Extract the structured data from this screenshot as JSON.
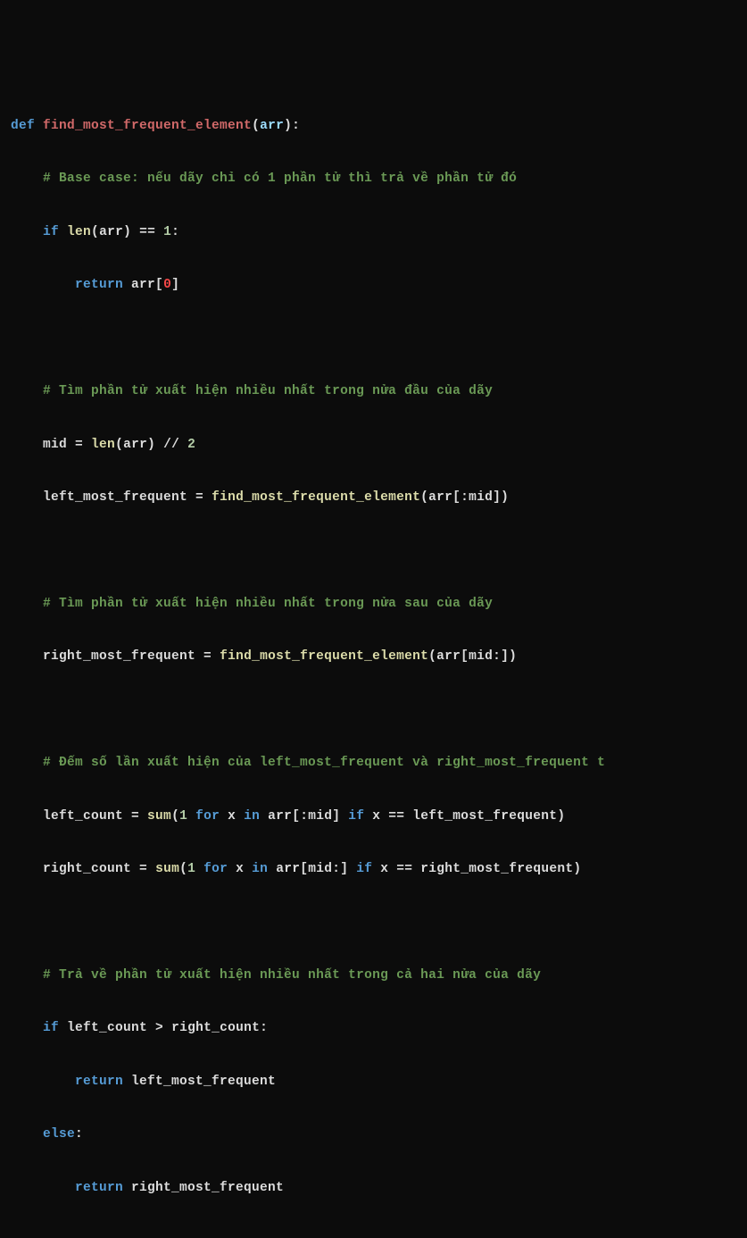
{
  "code": {
    "line1": {
      "def": "def ",
      "fname": "find_most_frequent_element",
      "paren_open": "(",
      "param": "arr",
      "paren_close_colon": "):"
    },
    "line2": {
      "indent": "    ",
      "comment": "# Base case: nếu dãy chỉ có 1 phần tử thì trả về phần tử đó"
    },
    "line3": {
      "indent": "    ",
      "if": "if ",
      "len": "len",
      "po": "(",
      "arr": "arr",
      "pc": ") ",
      "eq": "== ",
      "one": "1",
      "colon": ":"
    },
    "line4": {
      "indent": "        ",
      "return": "return ",
      "arr": "arr",
      "bo": "[",
      "zero": "0",
      "bc": "]"
    },
    "line5": {
      "blank": " "
    },
    "line6": {
      "indent": "    ",
      "comment": "# Tìm phần tử xuất hiện nhiều nhất trong nửa đầu của dãy"
    },
    "line7": {
      "indent": "    ",
      "mid": "mid ",
      "eq": "= ",
      "len": "len",
      "po": "(",
      "arr": "arr",
      "pc": ") ",
      "fd": "// ",
      "two": "2"
    },
    "line8": {
      "indent": "    ",
      "lmf": "left_most_frequent ",
      "eq": "= ",
      "fn": "find_most_frequent_element",
      "po": "(",
      "arr": "arr",
      "bo": "[:",
      "mid": "mid",
      "bc": "])"
    },
    "line9": {
      "blank": " "
    },
    "line10": {
      "indent": "    ",
      "comment": "# Tìm phần tử xuất hiện nhiều nhất trong nửa sau của dãy"
    },
    "line11": {
      "indent": "    ",
      "rmf": "right_most_frequent ",
      "eq": "= ",
      "fn": "find_most_frequent_element",
      "po": "(",
      "arr": "arr",
      "bo": "[",
      "mid": "mid",
      "bc": ":])"
    },
    "line12": {
      "blank": " "
    },
    "line13": {
      "indent": "    ",
      "comment": "# Đếm số lần xuất hiện của left_most_frequent và right_most_frequent t"
    },
    "line14": {
      "indent": "    ",
      "lc": "left_count ",
      "eq": "= ",
      "sum": "sum",
      "po": "(",
      "one": "1",
      "sp1": " ",
      "for": "for",
      "sp2": " ",
      "x": "x ",
      "in": "in ",
      "arr": "arr",
      "bo": "[:",
      "mid": "mid",
      "bc": "] ",
      "if": "if ",
      "x2": "x ",
      "eqeq": "== ",
      "lmf": "left_most_frequent",
      "pc": ")"
    },
    "line15": {
      "indent": "    ",
      "rc": "right_count ",
      "eq": "= ",
      "sum": "sum",
      "po": "(",
      "one": "1",
      "sp1": " ",
      "for": "for",
      "sp2": " ",
      "x": "x ",
      "in": "in ",
      "arr": "arr",
      "bo": "[",
      "mid": "mid",
      "bc": ":] ",
      "if": "if ",
      "x2": "x ",
      "eqeq": "== ",
      "rmf": "right_most_frequent",
      "pc": ")"
    },
    "line16": {
      "blank": " "
    },
    "line17": {
      "indent": "    ",
      "comment": "# Trả về phần tử xuất hiện nhiều nhất trong cả hai nửa của dãy"
    },
    "line18": {
      "indent": "    ",
      "if": "if ",
      "lc": "left_count ",
      "gt": "> ",
      "rc": "right_count",
      "colon": ":"
    },
    "line19": {
      "indent": "        ",
      "return": "return ",
      "lmf": "left_most_frequent"
    },
    "line20": {
      "indent": "    ",
      "else": "else",
      "colon": ":"
    },
    "line21": {
      "indent": "        ",
      "return": "return ",
      "rmf": "right_most_frequent"
    }
  }
}
